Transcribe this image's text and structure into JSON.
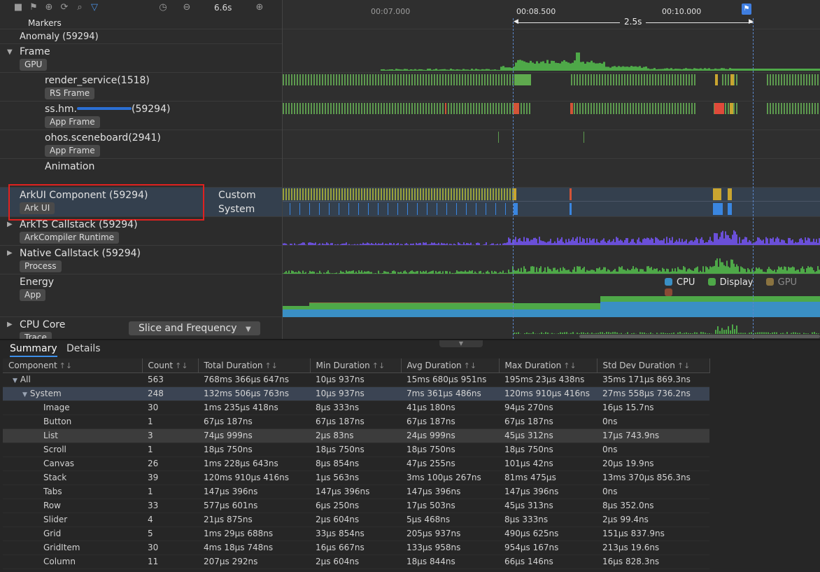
{
  "toolbar": {
    "zoom_label": "6.6s",
    "icons": [
      "checkbox-icon",
      "flag-icon",
      "add-circle-icon",
      "refresh-add-icon",
      "search-icon",
      "filter-icon",
      "clock-icon",
      "zoom-out-icon",
      "zoom-in-icon"
    ]
  },
  "ruler": {
    "ticks": [
      "00:07.000",
      "00:08.500",
      "00:10.000"
    ],
    "span_label": "2.5s"
  },
  "lanes": {
    "markers": "Markers",
    "anomaly": "Anomaly (59294)",
    "frame": {
      "title": "Frame",
      "tag": "GPU"
    },
    "render_service": {
      "title": "render_service(1518)",
      "tag": "RS Frame"
    },
    "app": {
      "title": "ss.hm.",
      "title_suffix": "(59294)",
      "tag": "App Frame"
    },
    "sceneboard": {
      "title": "ohos.sceneboard(2941)",
      "tag": "App Frame"
    },
    "animation": {
      "title": "Animation"
    },
    "arkui": {
      "title": "ArkUI Component (59294)",
      "tag": "Ark UI",
      "sub1": "Custom",
      "sub2": "System"
    },
    "arkts": {
      "title": "ArkTS Callstack (59294)",
      "tag": "ArkCompiler Runtime"
    },
    "native": {
      "title": "Native Callstack (59294)",
      "tag": "Process"
    },
    "energy": {
      "title": "Energy",
      "tag": "App"
    },
    "cpu": {
      "title": "CPU Core",
      "tag": "Trace",
      "dropdown": "Slice and Frequency"
    }
  },
  "energy_legend": [
    {
      "label": "CPU",
      "color": "#3a8fc4"
    },
    {
      "label": "Display",
      "color": "#4ea848"
    },
    {
      "label": "GPU",
      "color": "#8a7340"
    },
    {
      "label": "",
      "color": "#8a4a35"
    }
  ],
  "bottom": {
    "tabs": [
      "Summary",
      "Details"
    ],
    "columns": [
      "Component",
      "Count",
      "Total Duration",
      "Min Duration",
      "Avg Duration",
      "Max Duration",
      "Std Dev Duration"
    ],
    "rows": [
      {
        "name": "All",
        "level": 0,
        "count": "563",
        "total": "768ms 366µs 647ns",
        "min": "10µs 937ns",
        "avg": "15ms 680µs 951ns",
        "max": "195ms 23µs 438ns",
        "std": "35ms 171µs 869.3ns"
      },
      {
        "name": "System",
        "level": 1,
        "count": "248",
        "total": "132ms 506µs 763ns",
        "min": "10µs 937ns",
        "avg": "7ms 361µs 486ns",
        "max": "120ms 910µs 416ns",
        "std": "27ms 558µs 736.2ns"
      },
      {
        "name": "Image",
        "level": 2,
        "count": "30",
        "total": "1ms 235µs 418ns",
        "min": "8µs 333ns",
        "avg": "41µs 180ns",
        "max": "94µs 270ns",
        "std": "16µs 15.7ns"
      },
      {
        "name": "Button",
        "level": 2,
        "count": "1",
        "total": "67µs 187ns",
        "min": "67µs 187ns",
        "avg": "67µs 187ns",
        "max": "67µs 187ns",
        "std": "0ns"
      },
      {
        "name": "List",
        "level": 2,
        "count": "3",
        "total": "74µs 999ns",
        "min": "2µs 83ns",
        "avg": "24µs 999ns",
        "max": "45µs 312ns",
        "std": "17µs 743.9ns"
      },
      {
        "name": "Scroll",
        "level": 2,
        "count": "1",
        "total": "18µs 750ns",
        "min": "18µs 750ns",
        "avg": "18µs 750ns",
        "max": "18µs 750ns",
        "std": "0ns"
      },
      {
        "name": "Canvas",
        "level": 2,
        "count": "26",
        "total": "1ms 228µs 643ns",
        "min": "8µs 854ns",
        "avg": "47µs 255ns",
        "max": "101µs 42ns",
        "std": "20µs 19.9ns"
      },
      {
        "name": "Stack",
        "level": 2,
        "count": "39",
        "total": "120ms 910µs 416ns",
        "min": "1µs 563ns",
        "avg": "3ms 100µs 267ns",
        "max": "81ms 475µs",
        "std": "13ms 370µs 856.3ns"
      },
      {
        "name": "Tabs",
        "level": 2,
        "count": "1",
        "total": "147µs 396ns",
        "min": "147µs 396ns",
        "avg": "147µs 396ns",
        "max": "147µs 396ns",
        "std": "0ns"
      },
      {
        "name": "Row",
        "level": 2,
        "count": "33",
        "total": "577µs 601ns",
        "min": "6µs 250ns",
        "avg": "17µs 503ns",
        "max": "45µs 313ns",
        "std": "8µs 352.0ns"
      },
      {
        "name": "Slider",
        "level": 2,
        "count": "4",
        "total": "21µs 875ns",
        "min": "2µs 604ns",
        "avg": "5µs 468ns",
        "max": "8µs 333ns",
        "std": "2µs 99.4ns"
      },
      {
        "name": "Grid",
        "level": 2,
        "count": "5",
        "total": "1ms 29µs 688ns",
        "min": "33µs 854ns",
        "avg": "205µs 937ns",
        "max": "490µs 625ns",
        "std": "151µs 837.9ns"
      },
      {
        "name": "GridItem",
        "level": 2,
        "count": "30",
        "total": "4ms 18µs 748ns",
        "min": "16µs 667ns",
        "avg": "133µs 958ns",
        "max": "954µs 167ns",
        "std": "213µs 19.6ns"
      },
      {
        "name": "Column",
        "level": 2,
        "count": "11",
        "total": "207µs 292ns",
        "min": "2µs 604ns",
        "avg": "18µs 844ns",
        "max": "66µs 146ns",
        "std": "16µs 828.3ns"
      }
    ]
  }
}
